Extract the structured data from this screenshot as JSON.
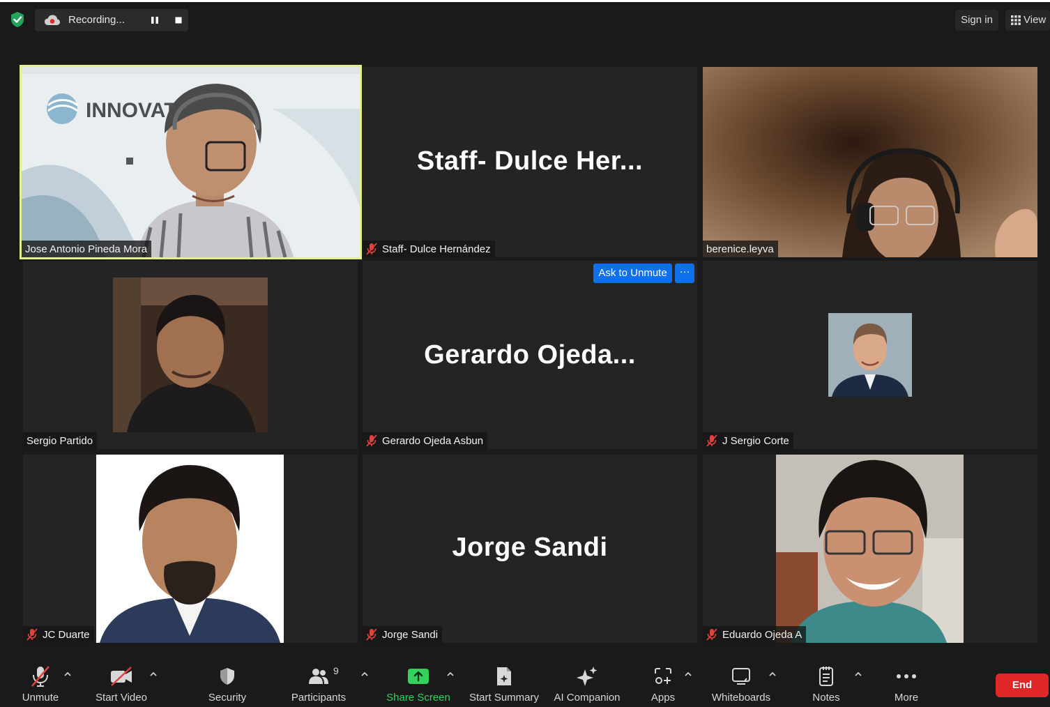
{
  "topbar": {
    "recording_label": "Recording...",
    "signin_label": "Sign in",
    "view_label": "View"
  },
  "tiles": [
    {
      "name": "Jose Antonio Pineda Mora",
      "muted": false,
      "active": true,
      "big_label": ""
    },
    {
      "name": "Staff- Dulce Hernández",
      "muted": true,
      "active": false,
      "big_label": "Staff-  Dulce  Her..."
    },
    {
      "name": "berenice.leyva",
      "muted": false,
      "active": false,
      "big_label": ""
    },
    {
      "name": "Sergio Partido",
      "muted": false,
      "active": false,
      "big_label": ""
    },
    {
      "name": "Gerardo Ojeda Asbun",
      "muted": true,
      "active": false,
      "big_label": "Gerardo  Ojeda..."
    },
    {
      "name": "J Sergio Corte",
      "muted": true,
      "active": false,
      "big_label": ""
    },
    {
      "name": "JC Duarte",
      "muted": true,
      "active": false,
      "big_label": ""
    },
    {
      "name": "Jorge Sandi",
      "muted": true,
      "active": false,
      "big_label": "Jorge Sandi"
    },
    {
      "name": "Eduardo Ojeda A",
      "muted": true,
      "active": false,
      "big_label": ""
    }
  ],
  "logo_text": "INNOVATIUM",
  "hover_controls": {
    "ask_to_unmute": "Ask to Unmute",
    "more": "···"
  },
  "toolbar": {
    "unmute": "Unmute",
    "start_video": "Start Video",
    "security": "Security",
    "participants": "Participants",
    "participants_count": "9",
    "share_screen": "Share Screen",
    "start_summary": "Start Summary",
    "ai_companion": "AI Companion",
    "apps": "Apps",
    "whiteboards": "Whiteboards",
    "notes": "Notes",
    "more": "More",
    "end": "End"
  },
  "colors": {
    "active_speaker_border": "#e5ef8a",
    "ask_button": "#0e71eb",
    "share_green": "#32d25c",
    "end_red": "#e02828",
    "muted_red": "#e0413c"
  }
}
